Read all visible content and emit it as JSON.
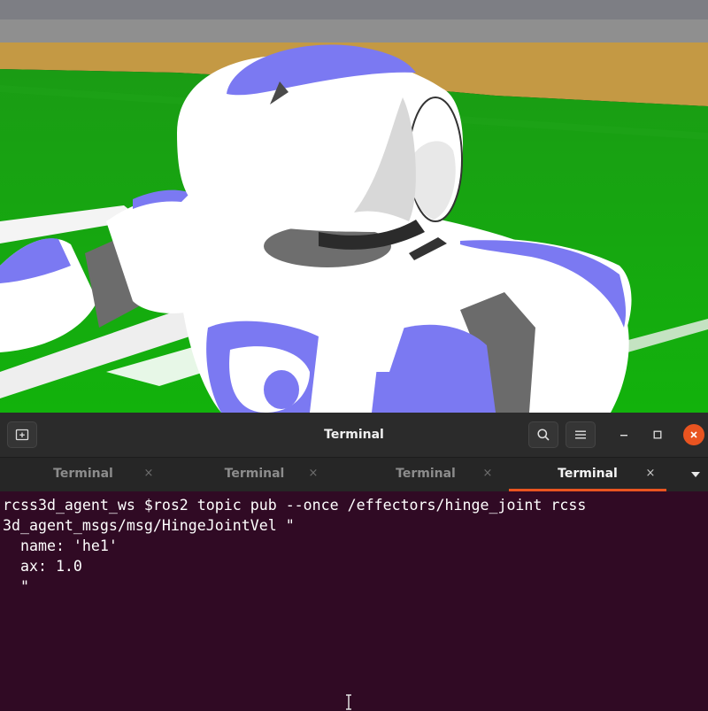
{
  "viewport": {
    "scene": "3D simulation view of a humanoid robot on a green soccer field",
    "colors": {
      "sky": "#8a8a8a",
      "wall": "#c69a46",
      "field": "#16b80f",
      "robot_body": "#ffffff",
      "robot_accent": "#7a78f0",
      "joint_gray": "#707070"
    }
  },
  "terminal": {
    "title": "Terminal",
    "icons": {
      "new_tab": "new-tab-icon",
      "search": "search-icon",
      "menu": "hamburger-menu-icon",
      "minimize": "minimize-icon",
      "maximize": "maximize-icon",
      "close": "close-icon"
    },
    "tabs": [
      {
        "label": "Terminal",
        "close": "×",
        "active": false
      },
      {
        "label": "Terminal",
        "close": "×",
        "active": false
      },
      {
        "label": "Terminal",
        "close": "×",
        "active": false
      },
      {
        "label": "Terminal",
        "close": "×",
        "active": true
      }
    ],
    "tab_accent": "#e95420",
    "background": "#300a24",
    "content": "rcss3d_agent_ws $ros2 topic pub --once /effectors/hinge_joint rcss\n3d_agent_msgs/msg/HingeJointVel \"\n  name: 'he1'\n  ax: 1.0\n  \""
  }
}
